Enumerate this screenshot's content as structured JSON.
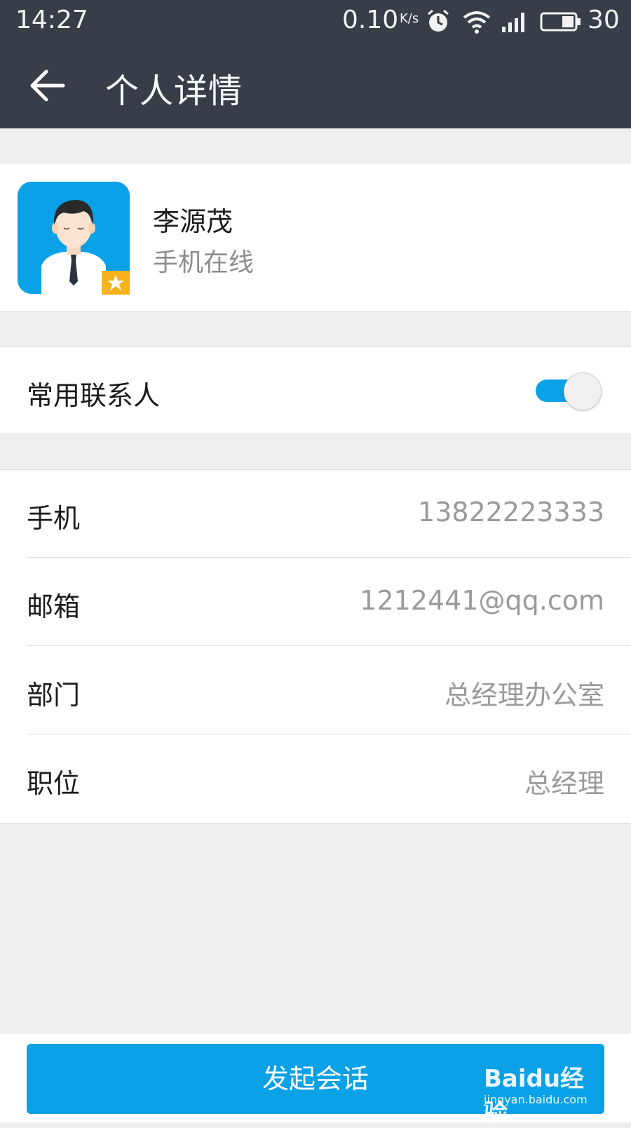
{
  "status_bar": {
    "time": "14:27",
    "net_speed": "0.10",
    "net_unit": "K/s",
    "battery": "30",
    "icons": [
      "alarm-icon",
      "wifi-icon",
      "4g-signal-icon",
      "battery-icon"
    ]
  },
  "nav": {
    "title": "个人详情",
    "back_icon": "back-arrow-icon"
  },
  "profile": {
    "name": "李源茂",
    "status": "手机在线",
    "badge_icon": "star-icon"
  },
  "favorite": {
    "label": "常用联系人",
    "enabled": true
  },
  "details": [
    {
      "label": "手机",
      "value": "13822223333"
    },
    {
      "label": "邮箱",
      "value": "1212441@qq.com"
    },
    {
      "label": "部门",
      "value": "总经理办公室"
    },
    {
      "label": "职位",
      "value": "总经理"
    }
  ],
  "action": {
    "label": "发起会话"
  },
  "watermark": {
    "logo": "Baidu经验",
    "url": "jingyan.baidu.com"
  },
  "colors": {
    "topbar": "#383e47",
    "accent": "#0aa1e6",
    "background": "#eeeff1"
  }
}
